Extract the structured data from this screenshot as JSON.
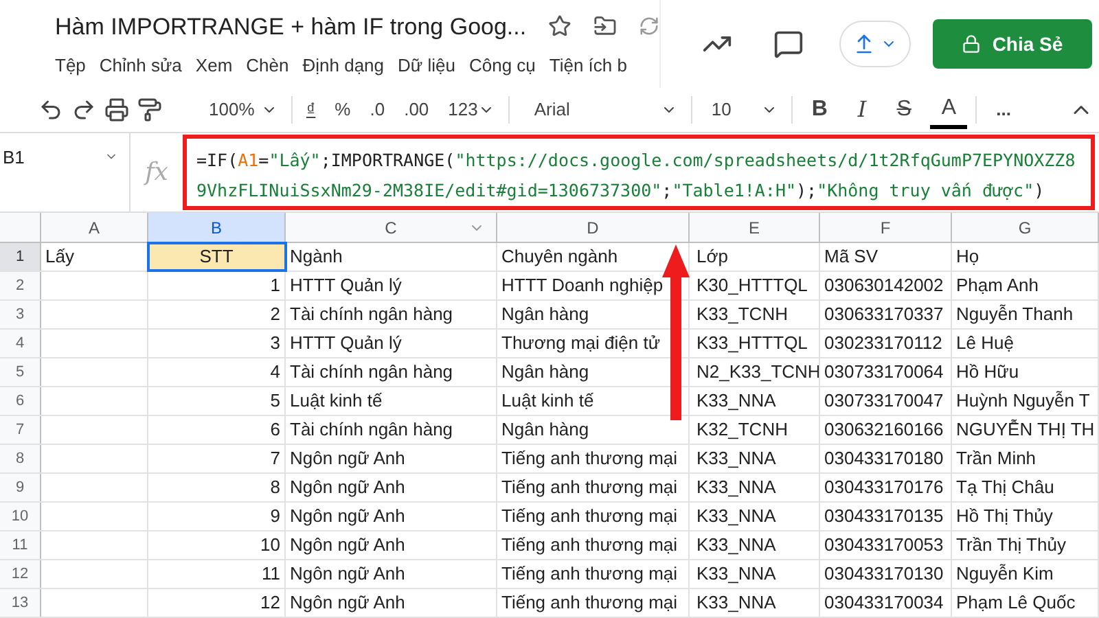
{
  "document": {
    "title": "Hàm IMPORTRANGE + hàm IF trong Goog..."
  },
  "menu": [
    "Tệp",
    "Chỉnh sửa",
    "Xem",
    "Chèn",
    "Định dạng",
    "Dữ liệu",
    "Công cụ",
    "Tiện ích b"
  ],
  "share_button": {
    "label": "Chia Sẻ"
  },
  "toolbar": {
    "zoom": "100%",
    "currency": "₫",
    "percent": "%",
    "decrease_decimals": ".0",
    "increase_decimals": ".00",
    "number_format": "123",
    "font": "Arial",
    "font_size": "10",
    "bold": "B",
    "italic": "I",
    "strikethrough": "S",
    "text_color": "A",
    "more": "..."
  },
  "formula_bar": {
    "cell_name": "B1",
    "fx": "fx",
    "formula": [
      {
        "kind": "plain",
        "text": "=IF("
      },
      {
        "kind": "ref",
        "text": "A1"
      },
      {
        "kind": "plain",
        "text": "="
      },
      {
        "kind": "string",
        "text": "\"Lấy\""
      },
      {
        "kind": "plain",
        "text": ";IMPORTRANGE("
      },
      {
        "kind": "string",
        "text": "\"https://docs.google.com/spreadsheets/d/1t2RfqGumP7EPYNOXZZ89VhzFLINuiSsxNm29-2M38IE/edit#gid=1306737300\""
      },
      {
        "kind": "plain",
        "text": ";"
      },
      {
        "kind": "string",
        "text": "\"Table1!A:H\""
      },
      {
        "kind": "plain",
        "text": ");"
      },
      {
        "kind": "string",
        "text": "\"Không truy vấn được\""
      },
      {
        "kind": "plain",
        "text": ")"
      }
    ]
  },
  "sheet": {
    "columns": [
      {
        "label": "A",
        "selected": false
      },
      {
        "label": "B",
        "selected": true
      },
      {
        "label": "C",
        "selected": false
      },
      {
        "label": "D",
        "selected": false
      },
      {
        "label": "E",
        "selected": false
      },
      {
        "label": "F",
        "selected": false
      },
      {
        "label": "G",
        "selected": false
      }
    ],
    "rows": [
      {
        "number": "1",
        "selected": true,
        "cells": [
          "Lấy",
          "STT",
          "Ngành",
          "Chuyên ngành",
          "Lớp",
          "Mã SV",
          "Họ"
        ]
      },
      {
        "number": "2",
        "selected": false,
        "cells": [
          "",
          "1",
          "HTTT Quản lý",
          "HTTT Doanh nghiệp",
          "K30_HTTTQL",
          "030630142002",
          "Phạm Anh"
        ]
      },
      {
        "number": "3",
        "selected": false,
        "cells": [
          "",
          "2",
          "Tài chính ngân hàng",
          "Ngân hàng",
          "K33_TCNH",
          "030633170337",
          "Nguyễn Thanh"
        ]
      },
      {
        "number": "4",
        "selected": false,
        "cells": [
          "",
          "3",
          "HTTT Quản lý",
          "Thương mại điện tử",
          "K33_HTTTQL",
          "030233170112",
          "Lê Huệ"
        ]
      },
      {
        "number": "5",
        "selected": false,
        "cells": [
          "",
          "4",
          "Tài chính ngân hàng",
          "Ngân hàng",
          "N2_K33_TCNH",
          "030733170064",
          "Hồ Hữu"
        ]
      },
      {
        "number": "6",
        "selected": false,
        "cells": [
          "",
          "5",
          "Luật kinh tế",
          "Luật kinh tế",
          "K33_NNA",
          "030733170047",
          "Huỳnh Nguyễn T"
        ]
      },
      {
        "number": "7",
        "selected": false,
        "cells": [
          "",
          "6",
          "Tài chính ngân hàng",
          "Ngân hàng",
          "K32_TCNH",
          "030632160166",
          "NGUYỄN THỊ TH"
        ]
      },
      {
        "number": "8",
        "selected": false,
        "cells": [
          "",
          "7",
          "Ngôn ngữ Anh",
          "Tiếng anh thương mại",
          "K33_NNA",
          "030433170180",
          "Trần Minh"
        ]
      },
      {
        "number": "9",
        "selected": false,
        "cells": [
          "",
          "8",
          "Ngôn ngữ Anh",
          "Tiếng anh thương mại",
          "K33_NNA",
          "030433170176",
          "Tạ Thị Châu"
        ]
      },
      {
        "number": "10",
        "selected": false,
        "cells": [
          "",
          "9",
          "Ngôn ngữ Anh",
          "Tiếng anh thương mại",
          "K33_NNA",
          "030433170135",
          "Hồ Thị Thủy"
        ]
      },
      {
        "number": "11",
        "selected": false,
        "cells": [
          "",
          "10",
          "Ngôn ngữ Anh",
          "Tiếng anh thương mại",
          "K33_NNA",
          "030433170053",
          "Trần Thị Thủy"
        ]
      },
      {
        "number": "12",
        "selected": false,
        "cells": [
          "",
          "11",
          "Ngôn ngữ Anh",
          "Tiếng anh thương mại",
          "K33_NNA",
          "030433170130",
          "Nguyễn Kim"
        ]
      },
      {
        "number": "13",
        "selected": false,
        "cells": [
          "",
          "12",
          "Ngôn ngữ Anh",
          "Tiếng anh thương mại",
          "K33_NNA",
          "030433170034",
          "Phạm Lê Quốc"
        ]
      }
    ]
  }
}
